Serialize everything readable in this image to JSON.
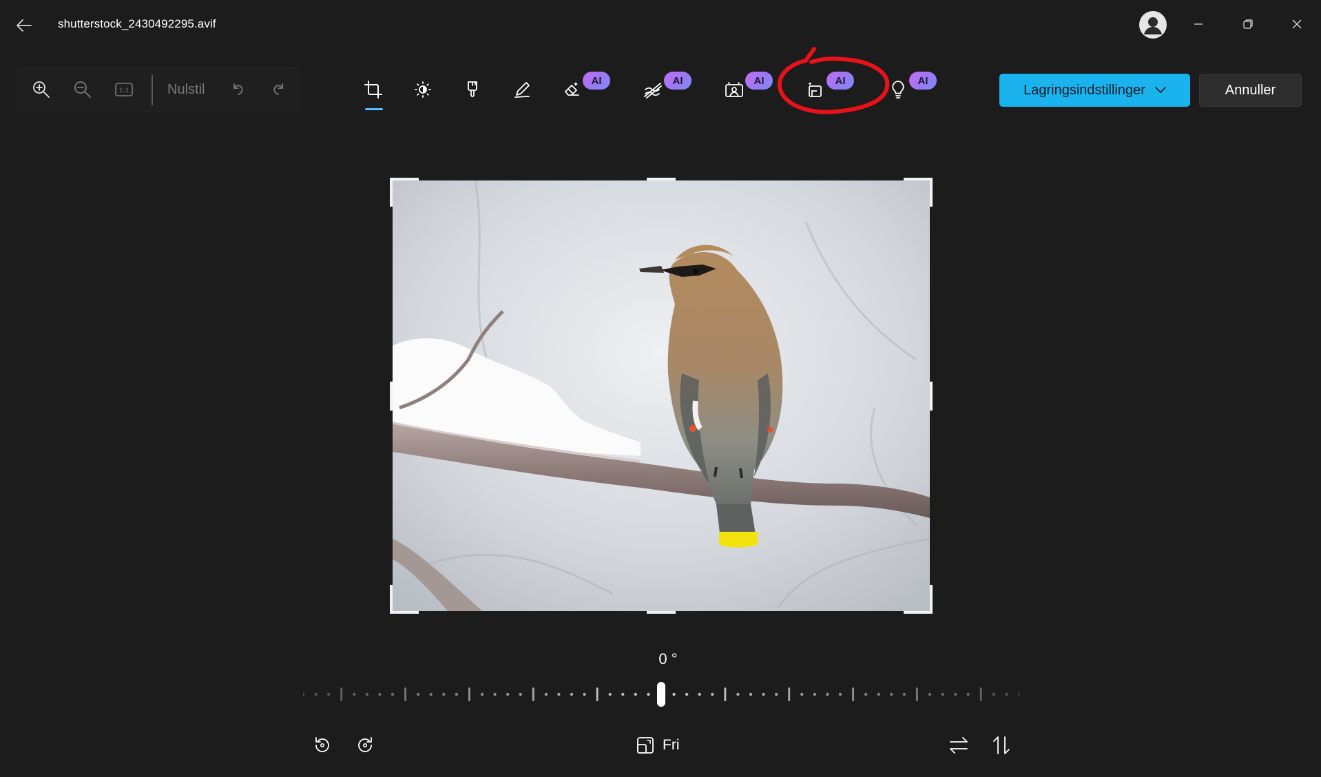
{
  "window": {
    "title": "shutterstock_2430492295.avif",
    "controls": [
      "minimize-icon",
      "restore-icon",
      "close-icon"
    ]
  },
  "toolbar": {
    "reset_label": "Nulstil",
    "left_tools": [
      "zoom-in-icon",
      "zoom-out-icon",
      "actual-size-icon",
      "undo-icon",
      "redo-icon"
    ],
    "ai_badge_label": "AI",
    "tools": [
      {
        "name": "crop",
        "icon": "crop-icon",
        "ai": false,
        "active": true
      },
      {
        "name": "adjust",
        "icon": "brightness-icon",
        "ai": false
      },
      {
        "name": "filter",
        "icon": "filter-brush-icon",
        "ai": false
      },
      {
        "name": "markup",
        "icon": "markup-pen-icon",
        "ai": false
      },
      {
        "name": "erase",
        "icon": "eraser-icon",
        "ai": true
      },
      {
        "name": "blur-background",
        "icon": "blur-icon",
        "ai": true
      },
      {
        "name": "background",
        "icon": "background-image-icon",
        "ai": true
      },
      {
        "name": "generative",
        "icon": "generative-fill-icon",
        "ai": true
      },
      {
        "name": "lighting",
        "icon": "lightbulb-icon",
        "ai": true
      }
    ],
    "save_label": "Lagringsindstillinger",
    "cancel_label": "Annuller"
  },
  "annotation": {
    "color": "#e8121a",
    "target": "generative"
  },
  "canvas": {
    "image": "cedar-waxwing-on-snowy-branch"
  },
  "rotation": {
    "label": "0 °",
    "value_degrees": 0
  },
  "bottom": {
    "aspect_label": "Fri"
  },
  "colors": {
    "accent": "#1ab3ee",
    "background": "#1c1c1c",
    "ai_badge": "#b57cf3"
  }
}
